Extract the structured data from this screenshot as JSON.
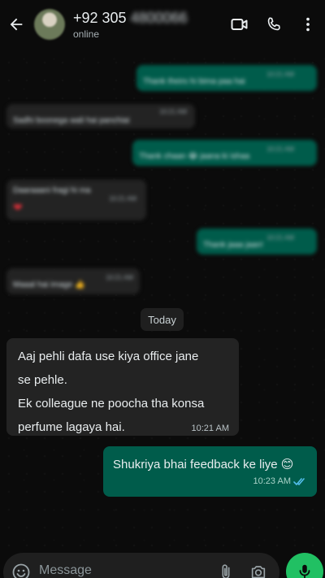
{
  "header": {
    "contact_name_visible": "+92 305",
    "contact_name_hidden": "4800066",
    "status": "online"
  },
  "blurred_messages": [
    {
      "text": "Thank theirs hi bima paa hai",
      "time": "10:21 AM"
    },
    {
      "text": "Sadhi boonega wali hai panchiai",
      "time": "10:21 AM"
    },
    {
      "text": "Thank chaan 😂 jaana ki ishaa",
      "time": "10:21 AM"
    },
    {
      "text": "Daaraaani fragi hi ma",
      "time": "10:21 AM"
    },
    {
      "text": "Thank jaaa jaan!",
      "time": "10:21 AM"
    },
    {
      "text": "Maaal hai image 👍",
      "time": "10:21 AM"
    }
  ],
  "day_separator": "Today",
  "messages": [
    {
      "direction": "incoming",
      "lines": [
        "Aaj pehli dafa use kiya office jane",
        "se pehle.",
        "Ek colleague ne poocha tha konsa",
        "perfume lagaya hai."
      ],
      "time": "10:21 AM"
    },
    {
      "direction": "outgoing",
      "text": "Shukriya bhai feedback ke liye 😊",
      "time": "10:23 AM",
      "read": true
    }
  ],
  "composer": {
    "placeholder": "Message"
  },
  "colors": {
    "background": "#0b0b0b",
    "incoming_bubble": "#232323",
    "outgoing_bubble": "#005c4b",
    "read_ticks": "#53bdeb",
    "mic_button": "#21c063"
  },
  "icons": [
    "back-arrow-icon",
    "video-call-icon",
    "phone-icon",
    "more-vertical-icon",
    "emoji-icon",
    "attach-icon",
    "camera-icon",
    "mic-icon",
    "double-check-icon"
  ]
}
